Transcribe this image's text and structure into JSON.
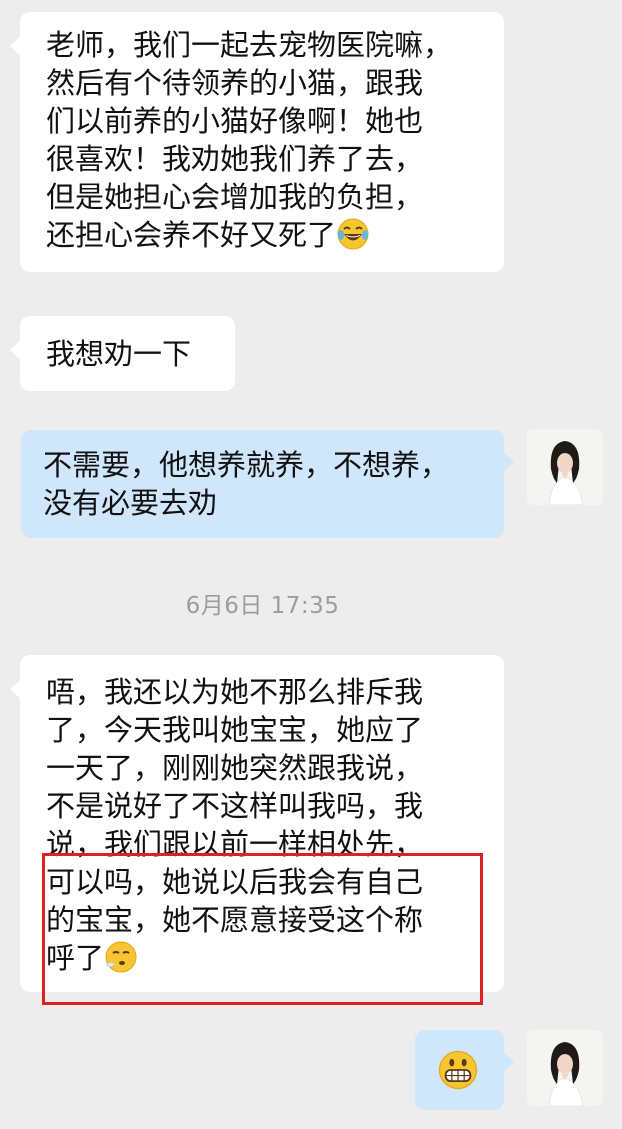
{
  "messages": [
    {
      "side": "left",
      "lines": [
        "老师，我们一起去宠物医院嘛，",
        "然后有个待领养的小猫，跟我",
        "们以前养的小猫好像啊！她也",
        "很喜欢！我劝她我们养了去，",
        "但是她担心会增加我的负担，",
        "还担心会养不好又死了"
      ],
      "trailing_emoji": "laughing-with-tears-emoji"
    },
    {
      "side": "left",
      "lines": [
        "我想劝一下"
      ]
    },
    {
      "side": "right",
      "lines": [
        "不需要，他想养就养，不想养，",
        "没有必要去劝"
      ]
    },
    {
      "side": "left",
      "lines": [
        "唔，我还以为她不那么排斥我",
        "了，今天我叫她宝宝，她应了",
        "一天了，刚刚她突然跟我说，",
        "不是说好了不这样叫我吗，我",
        "说，我们跟以前一样相处先，",
        "可以吗，她说以后我会有自己",
        "的宝宝，她不愿意接受这个称",
        "呼了"
      ],
      "trailing_emoji": "sighing-face-emoji",
      "highlighted_lines": [
        5,
        6,
        7
      ]
    },
    {
      "side": "right",
      "emoji_only": "grinning-face-emoji"
    }
  ],
  "timestamp": "6月6日 17:35",
  "colors": {
    "background": "#ededed",
    "bubble_left": "#ffffff",
    "bubble_right": "#cfe6fb",
    "highlight": "#e02020"
  }
}
